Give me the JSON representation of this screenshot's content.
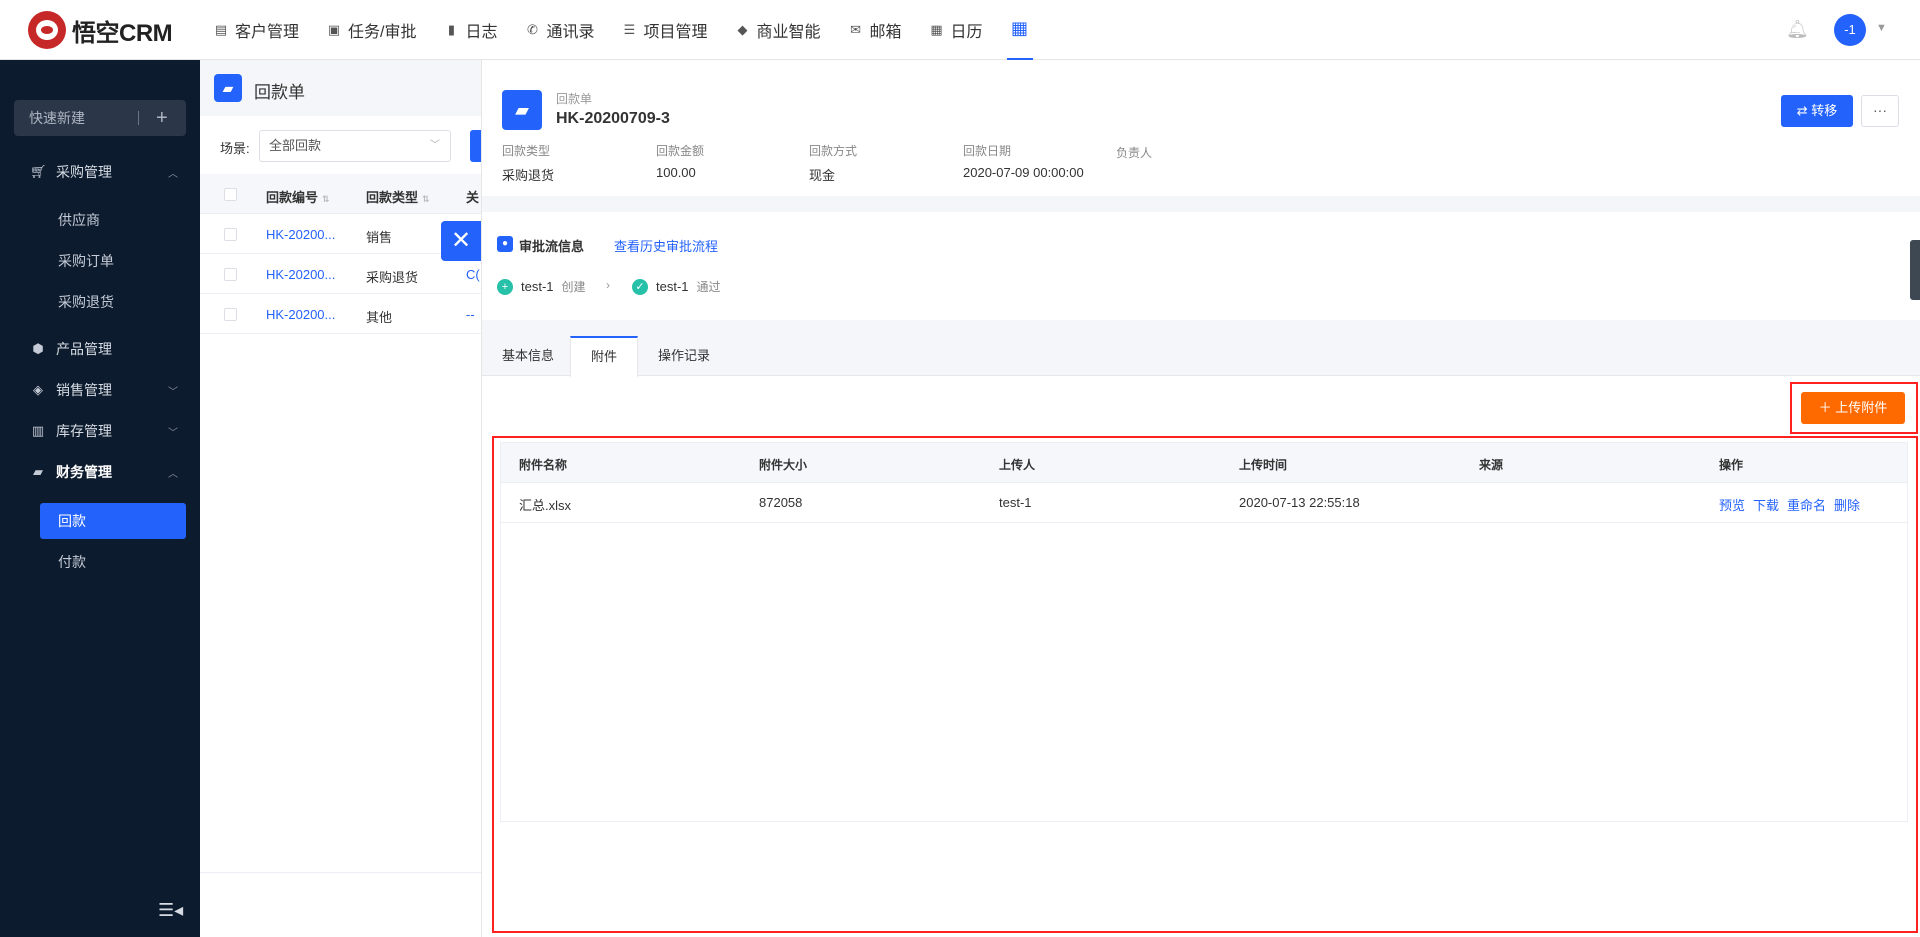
{
  "topnav": {
    "logo_text": "悟空CRM",
    "items": [
      {
        "label": "客户管理",
        "icon": "building-icon"
      },
      {
        "label": "任务/审批",
        "icon": "briefcase-icon"
      },
      {
        "label": "日志",
        "icon": "log-icon"
      },
      {
        "label": "通讯录",
        "icon": "phone-icon"
      },
      {
        "label": "项目管理",
        "icon": "project-icon"
      },
      {
        "label": "商业智能",
        "icon": "bi-icon"
      },
      {
        "label": "邮箱",
        "icon": "mail-icon"
      },
      {
        "label": "日历",
        "icon": "calendar-icon"
      }
    ],
    "avatar_text": "-1"
  },
  "sidebar": {
    "quick_new": "快速新建",
    "groups": [
      {
        "label": "采购管理",
        "expanded": true,
        "children": [
          "供应商",
          "采购订单",
          "采购退货"
        ]
      },
      {
        "label": "产品管理"
      },
      {
        "label": "销售管理",
        "expanded": false
      },
      {
        "label": "库存管理",
        "expanded": false
      },
      {
        "label": "财务管理",
        "expanded": true,
        "children": [
          "回款",
          "付款"
        ]
      }
    ],
    "active_item": "回款"
  },
  "list": {
    "title": "回款单",
    "scene_label": "场景:",
    "scene_value": "全部回款",
    "columns": [
      "回款编号",
      "回款类型",
      "关"
    ],
    "rows": [
      {
        "no": "HK-20200...",
        "type": "销售",
        "rel": ""
      },
      {
        "no": "HK-20200...",
        "type": "采购退货",
        "rel": "C("
      },
      {
        "no": "HK-20200...",
        "type": "其他",
        "rel": "--"
      }
    ]
  },
  "detail": {
    "subtitle": "回款单",
    "title": "HK-20200709-3",
    "transfer_label": "转移",
    "more_label": "···",
    "fields": [
      {
        "label": "回款类型",
        "value": "采购退货"
      },
      {
        "label": "回款金额",
        "value": "100.00"
      },
      {
        "label": "回款方式",
        "value": "现金"
      },
      {
        "label": "回款日期",
        "value": "2020-07-09 00:00:00"
      },
      {
        "label": "负责人",
        "value": ""
      }
    ],
    "approval": {
      "title": "审批流信息",
      "history_link": "查看历史审批流程",
      "steps": [
        {
          "user": "test-1",
          "action": "创建",
          "status": "create"
        },
        {
          "user": "test-1",
          "action": "通过",
          "status": "pass"
        }
      ]
    },
    "tabs": [
      "基本信息",
      "附件",
      "操作记录"
    ],
    "active_tab": "附件",
    "upload_label": "上传附件",
    "attachments": {
      "columns": [
        "附件名称",
        "附件大小",
        "上传人",
        "上传时间",
        "来源",
        "操作"
      ],
      "rows": [
        {
          "name": "汇总.xlsx",
          "size": "872058",
          "uploader": "test-1",
          "time": "2020-07-13 22:55:18",
          "source": ""
        }
      ],
      "ops": [
        "预览",
        "下载",
        "重命名",
        "删除"
      ]
    }
  },
  "colors": {
    "primary": "#2362fb",
    "sidebar_bg": "#0d1b2e",
    "upload": "#ff6a00",
    "highlight": "#ff2020"
  }
}
